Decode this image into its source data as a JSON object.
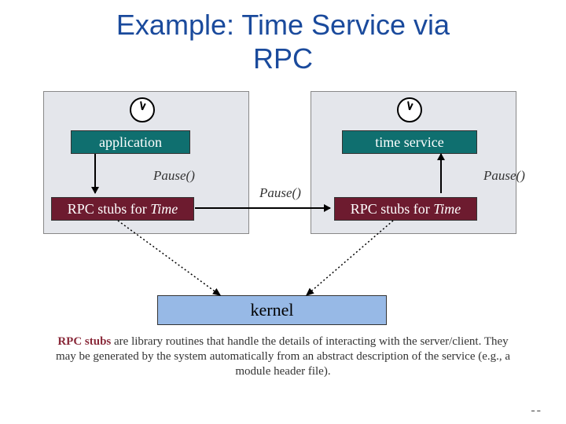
{
  "title_line1": "Example: Time Service via",
  "title_line2": "RPC",
  "boxes": {
    "application": "application",
    "time_service": "time service",
    "stub_left": "RPC stubs for ",
    "stub_left_em": "Time",
    "stub_right": "RPC stubs for ",
    "stub_right_em": "Time",
    "kernel": "kernel"
  },
  "labels": {
    "pause1": "Pause()",
    "pause2": "Pause()",
    "pause3": "Pause()"
  },
  "caption": {
    "lead": "RPC stubs",
    "rest": " are library routines that handle the details of interacting with the server/client.  They may be generated by the system automatically from an abstract description of the service (e.g., a module header file)."
  },
  "page_marker": "--"
}
